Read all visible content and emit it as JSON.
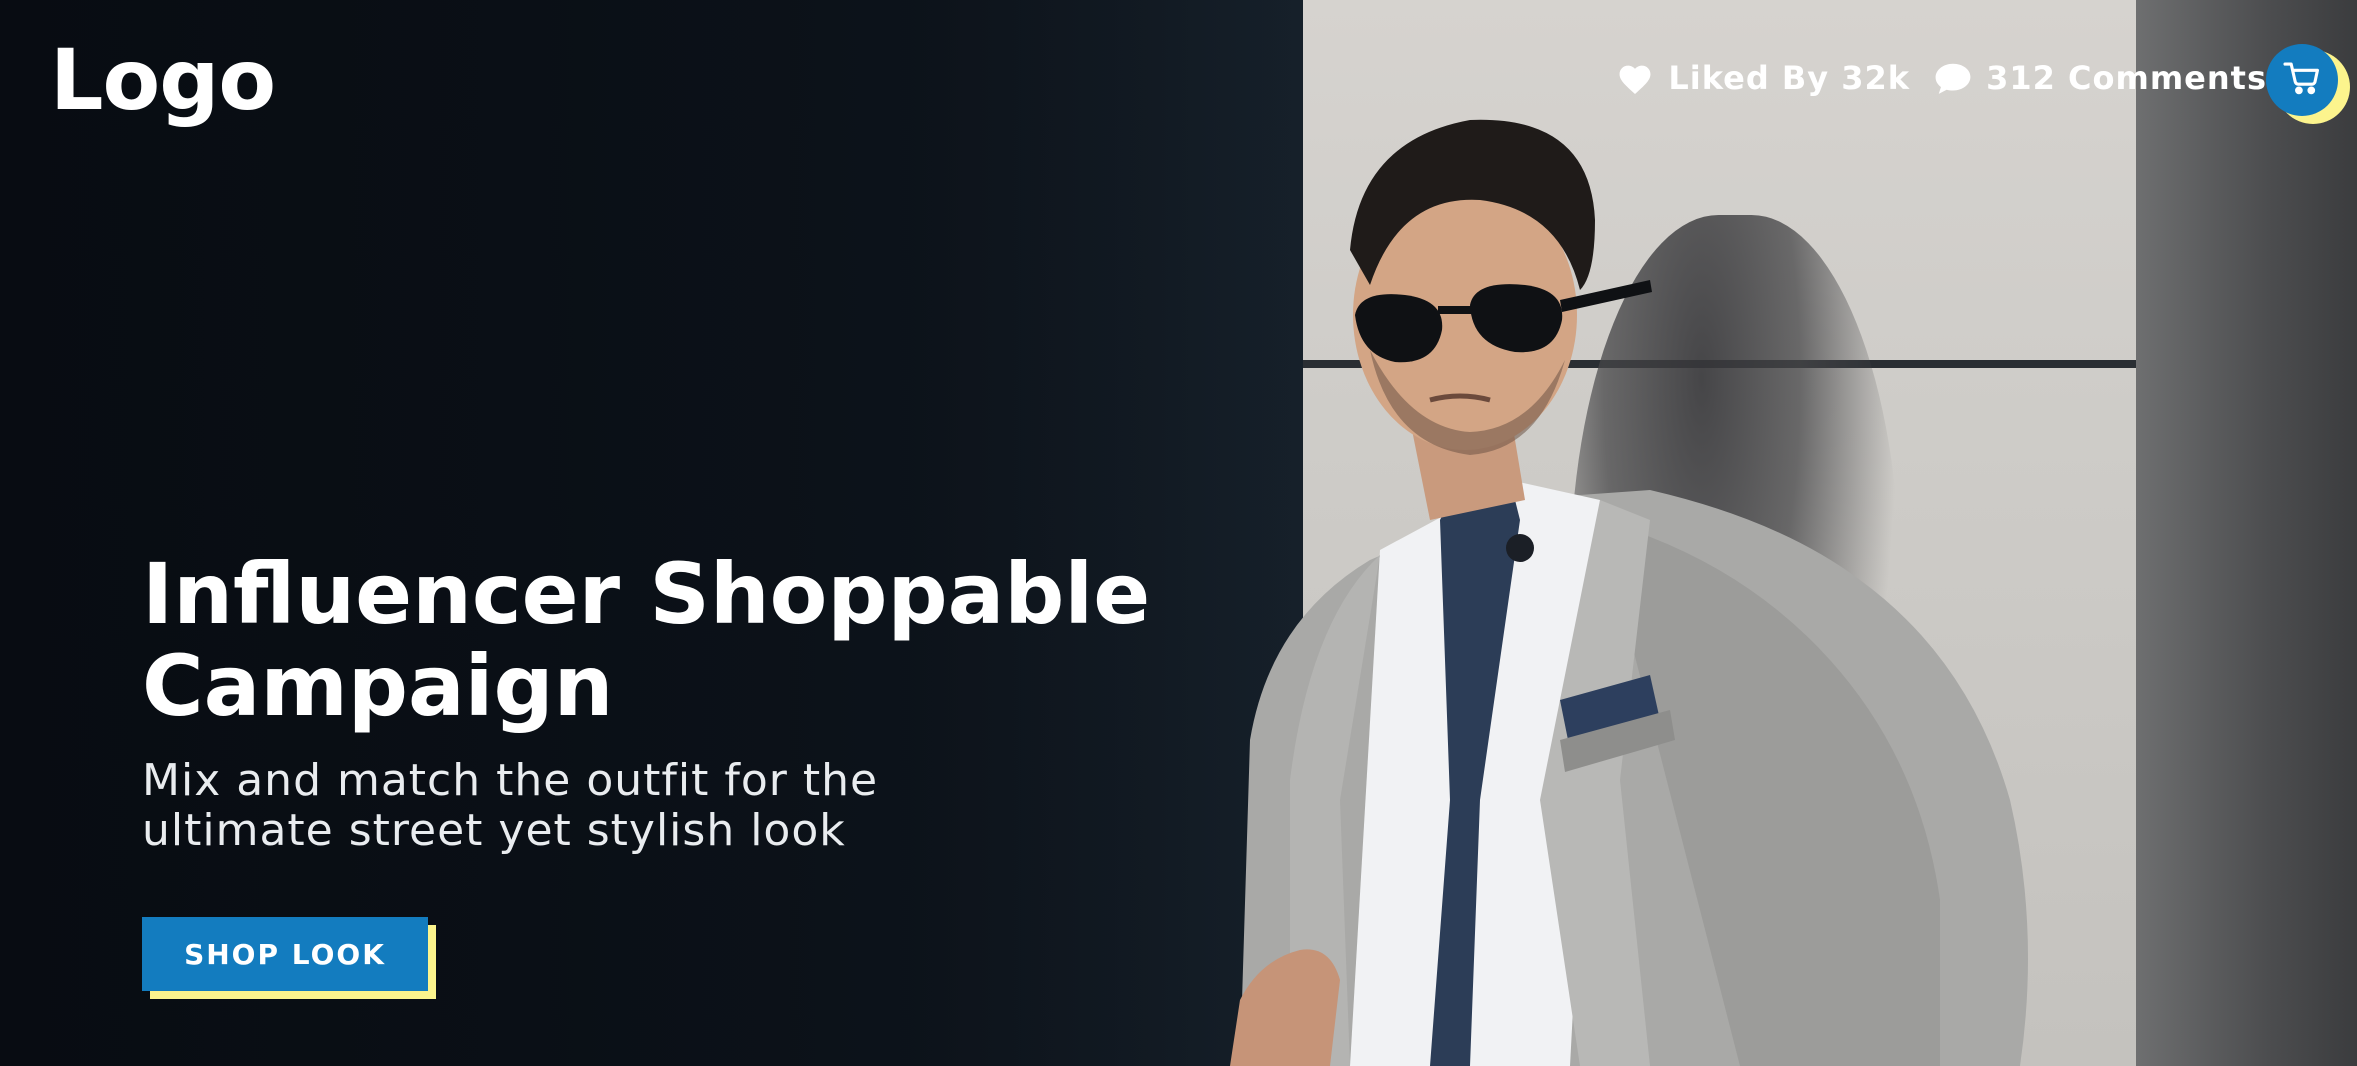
{
  "header": {
    "logo_text": "Logo",
    "likes_text": "Liked By 32k",
    "comments_text": "312 Comments",
    "like_icon": "heart-icon",
    "comment_icon": "comment-bubble-icon",
    "cart_icon": "shopping-cart-icon"
  },
  "hero": {
    "headline_line1": "Influencer Shoppable",
    "headline_line2": "Campaign",
    "subheadline_line1": "Mix and match the outfit for the",
    "subheadline_line2": "ultimate street yet stylish look",
    "cta_label": "SHOP LOOK",
    "image_subject": "man in grey suit and sunglasses leaning against wall"
  },
  "colors": {
    "accent_blue": "#137cbf",
    "accent_yellow": "#fcf48d",
    "background_dark": "#0b1118",
    "text_white": "#ffffff"
  }
}
